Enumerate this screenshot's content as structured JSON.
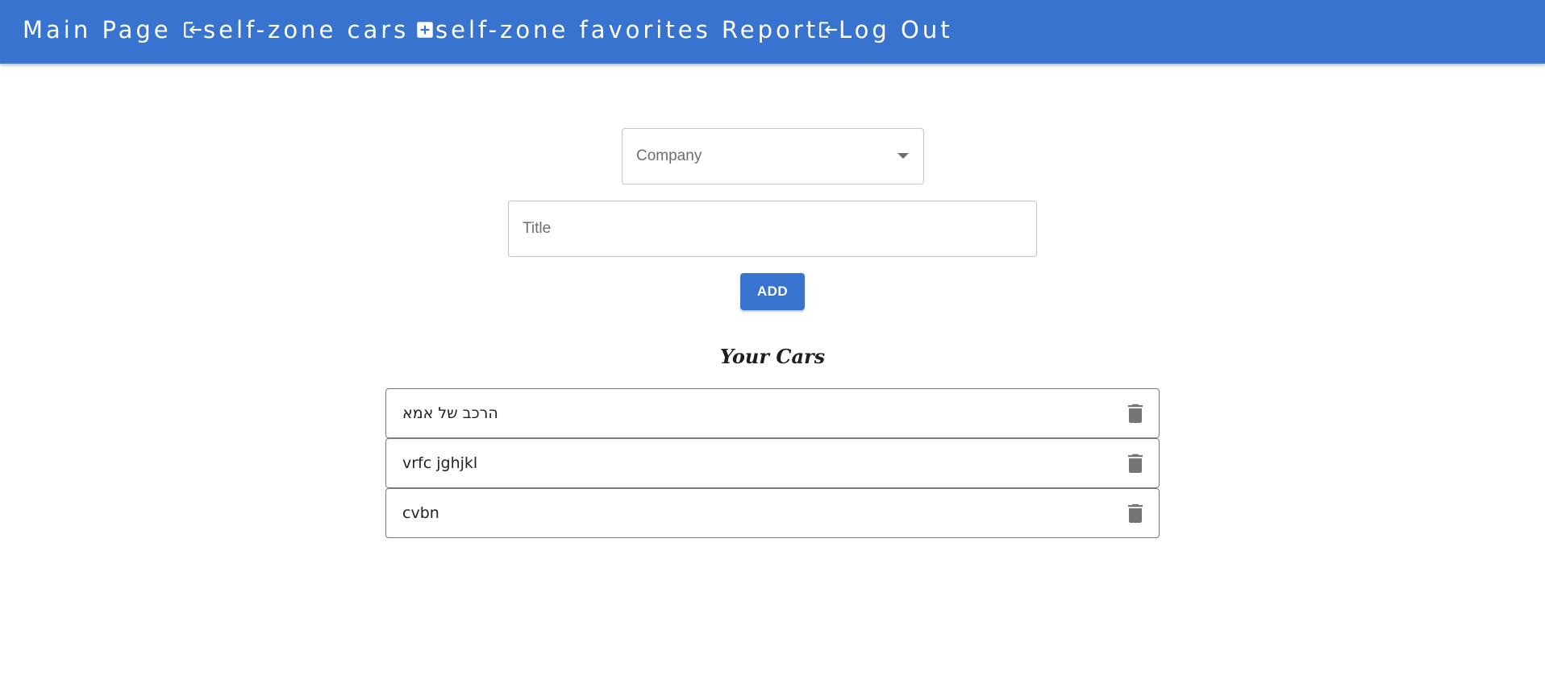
{
  "nav": {
    "items": [
      {
        "label": "Main Page",
        "icon": null
      },
      {
        "label": "self-zone cars",
        "icon": "login-icon"
      },
      {
        "label": "self-zone favorites Report",
        "icon": "add-box-icon"
      },
      {
        "label": "Log Out",
        "icon": "login-icon"
      }
    ]
  },
  "form": {
    "company_placeholder": "Company",
    "title_placeholder": "Title",
    "add_label": "ADD"
  },
  "cars": {
    "heading": "Your Cars",
    "items": [
      {
        "name": "הרכב של אמא"
      },
      {
        "name": "vrfc jghjkl"
      },
      {
        "name": "cvbn"
      }
    ]
  },
  "colors": {
    "primary": "#3874cf",
    "border": "#c4c4c4",
    "icon_gray": "#757575"
  }
}
